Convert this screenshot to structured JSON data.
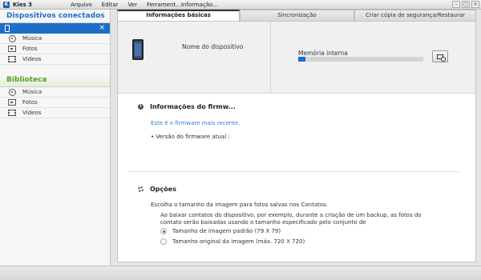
{
  "app": {
    "title": "Kies 3",
    "logo": "kies-logo"
  },
  "menu": [
    "Arquivo",
    "Editar",
    "Ver",
    "Ferrament...",
    "Informação..."
  ],
  "sidebar": {
    "connected_header": "Dispositivos conectados",
    "connected_items": [
      {
        "label": "Música",
        "icon": "music-icon"
      },
      {
        "label": "Fotos",
        "icon": "photo-icon"
      },
      {
        "label": "Vídeos",
        "icon": "video-icon"
      }
    ],
    "library_header": "Biblioteca",
    "library_items": [
      {
        "label": "Música",
        "icon": "music-icon"
      },
      {
        "label": "Fotos",
        "icon": "photo-icon"
      },
      {
        "label": "Vídeos",
        "icon": "video-icon"
      }
    ]
  },
  "tabs": [
    "Informações básicas",
    "Sincronização",
    "Criar cópia de segurança/Restaurar"
  ],
  "device": {
    "name_label": "Nome do dispositivo",
    "memory_label": "Memória interna",
    "memory_used_fraction": 0.06
  },
  "firmware": {
    "title": "Informações do firmw...",
    "status": "Este é o firmware mais recente.",
    "version_label": "• Versão do firmware atual :"
  },
  "options": {
    "title": "Opções",
    "description": "Escolha o tamanho da imagem para fotos salvas nos Contatos.",
    "detail": "Ao baixar contatos do dispositivo, por exemplo, durante a criação de um backup, as fotos do contato serão baixadas usando o tamanho especificado pelo conjunto de",
    "radio_default": "Tamanho de imagem padrão (79 X 79)",
    "radio_original": "Tamanho original da imagem (máx. 720 X 720)",
    "selected": "default"
  },
  "colors": {
    "accent": "#1e6ec8",
    "library": "#5a9f1f",
    "link": "#2f7fd8"
  }
}
